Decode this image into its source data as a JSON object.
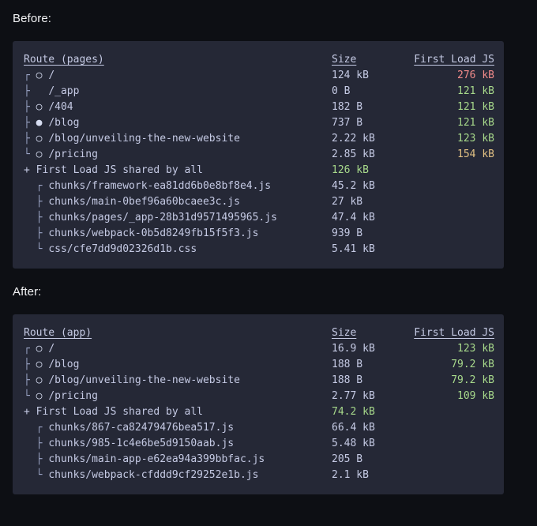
{
  "sections": [
    {
      "label": "Before:",
      "label_name": "before-label",
      "block_name": "before-code-block",
      "headers": {
        "route": "Route (pages)",
        "size": "Size",
        "first_load": "First Load JS"
      },
      "routes": [
        {
          "tree": "┌",
          "marker": "○",
          "path": "/",
          "size": "124 kB",
          "first_load": "276 kB",
          "fl_color": "red"
        },
        {
          "tree": "├",
          "marker": " ",
          "path": "/_app",
          "size": "0 B",
          "first_load": "121 kB",
          "fl_color": "green"
        },
        {
          "tree": "├",
          "marker": "○",
          "path": "/404",
          "size": "182 B",
          "first_load": "121 kB",
          "fl_color": "green"
        },
        {
          "tree": "├",
          "marker": "●",
          "path": "/blog",
          "size": "737 B",
          "first_load": "121 kB",
          "fl_color": "green"
        },
        {
          "tree": "├",
          "marker": "○",
          "path": "/blog/unveiling-the-new-website",
          "size": "2.22 kB",
          "first_load": "123 kB",
          "fl_color": "green"
        },
        {
          "tree": "└",
          "marker": "○",
          "path": "/pricing",
          "size": "2.85 kB",
          "first_load": "154 kB",
          "fl_color": "yellow"
        }
      ],
      "shared": {
        "prefix": "+",
        "label": "First Load JS shared by all",
        "size": "126 kB",
        "size_color": "green"
      },
      "chunks": [
        {
          "tree": "┌",
          "name": "chunks/framework-ea81dd6b0e8bf8e4.js",
          "size": "45.2 kB"
        },
        {
          "tree": "├",
          "name": "chunks/main-0bef96a60bcaee3c.js",
          "size": "27 kB"
        },
        {
          "tree": "├",
          "name": "chunks/pages/_app-28b31d9571495965.js",
          "size": "47.4 kB"
        },
        {
          "tree": "├",
          "name": "chunks/webpack-0b5d8249fb15f5f3.js",
          "size": "939 B"
        },
        {
          "tree": "└",
          "name": "css/cfe7dd9d02326d1b.css",
          "size": "5.41 kB"
        }
      ]
    },
    {
      "label": "After:",
      "label_name": "after-label",
      "block_name": "after-code-block",
      "headers": {
        "route": "Route (app)",
        "size": "Size",
        "first_load": "First Load JS"
      },
      "routes": [
        {
          "tree": "┌",
          "marker": "○",
          "path": "/",
          "size": "16.9 kB",
          "first_load": "123 kB",
          "fl_color": "green"
        },
        {
          "tree": "├",
          "marker": "○",
          "path": "/blog",
          "size": "188 B",
          "first_load": "79.2 kB",
          "fl_color": "green"
        },
        {
          "tree": "├",
          "marker": "○",
          "path": "/blog/unveiling-the-new-website",
          "size": "188 B",
          "first_load": "79.2 kB",
          "fl_color": "green"
        },
        {
          "tree": "└",
          "marker": "○",
          "path": "/pricing",
          "size": "2.77 kB",
          "first_load": "109 kB",
          "fl_color": "green"
        }
      ],
      "shared": {
        "prefix": "+",
        "label": "First Load JS shared by all",
        "size": "74.2 kB",
        "size_color": "green"
      },
      "chunks": [
        {
          "tree": "┌",
          "name": "chunks/867-ca82479476bea517.js",
          "size": "66.4 kB"
        },
        {
          "tree": "├",
          "name": "chunks/985-1c4e6be5d9150aab.js",
          "size": "5.48 kB"
        },
        {
          "tree": "├",
          "name": "chunks/main-app-e62ea94a399bbfac.js",
          "size": "205 B"
        },
        {
          "tree": "└",
          "name": "chunks/webpack-cfddd9cf29252e1b.js",
          "size": "2.1 kB"
        }
      ]
    }
  ],
  "colors": {
    "page_background": "#0d0f14",
    "block_background": "#252836",
    "text": "#c5cae4",
    "green": "#a7d98b",
    "red": "#f28b8b",
    "yellow": "#e2c184",
    "tree": "#9aa3c4"
  }
}
